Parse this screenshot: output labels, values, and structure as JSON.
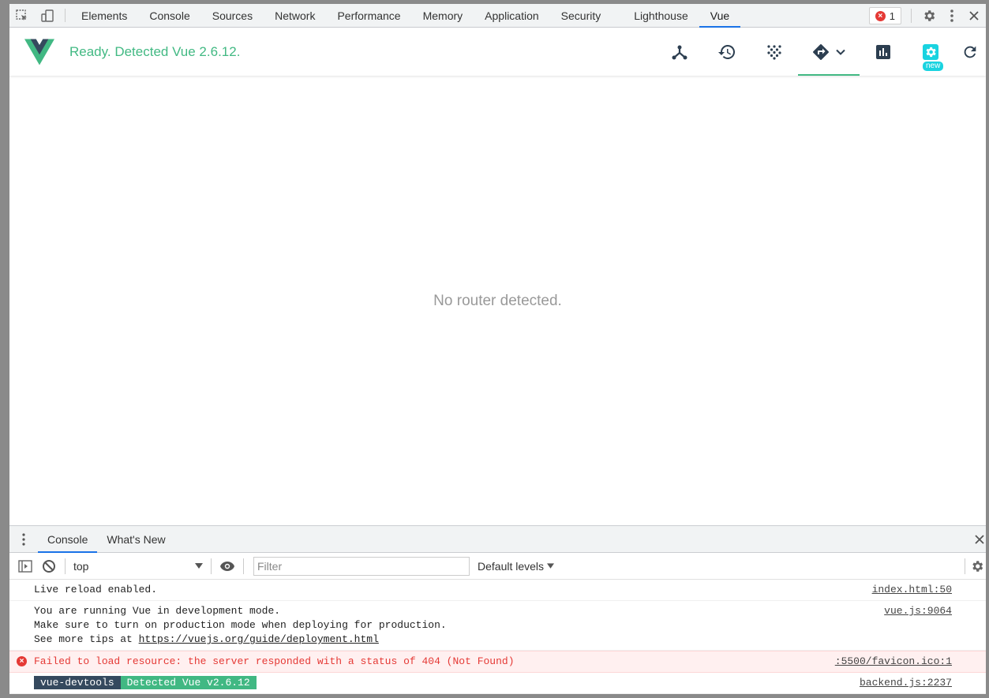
{
  "devtools": {
    "tabs": [
      "Elements",
      "Console",
      "Sources",
      "Network",
      "Performance",
      "Memory",
      "Application",
      "Security",
      "Lighthouse",
      "Vue"
    ],
    "active_tab": "Vue",
    "error_count": "1"
  },
  "vue": {
    "status": "Ready. Detected Vue 2.6.12.",
    "new_badge": "new",
    "empty_message": "No router detected.",
    "brand_color": "#42b983"
  },
  "drawer": {
    "tabs": [
      "Console",
      "What's New"
    ],
    "context": "top",
    "filter_placeholder": "Filter",
    "levels": "Default levels"
  },
  "logs": [
    {
      "lines": [
        "Live reload enabled."
      ],
      "source": "index.html:50"
    },
    {
      "lines": [
        "You are running Vue in development mode.",
        "Make sure to turn on production mode when deploying for production."
      ],
      "tip_prefix": "See more tips at ",
      "tip_link": "https://vuejs.org/guide/deployment.html",
      "source": "vue.js:9064"
    },
    {
      "lines": [
        "Failed to load resource: the server responded with a status of 404 (Not Found)"
      ],
      "source": ":5500/favicon.ico:1"
    },
    {
      "badge_a": "vue-devtools",
      "badge_b": "Detected Vue v2.6.12",
      "source": "backend.js:2237"
    }
  ]
}
